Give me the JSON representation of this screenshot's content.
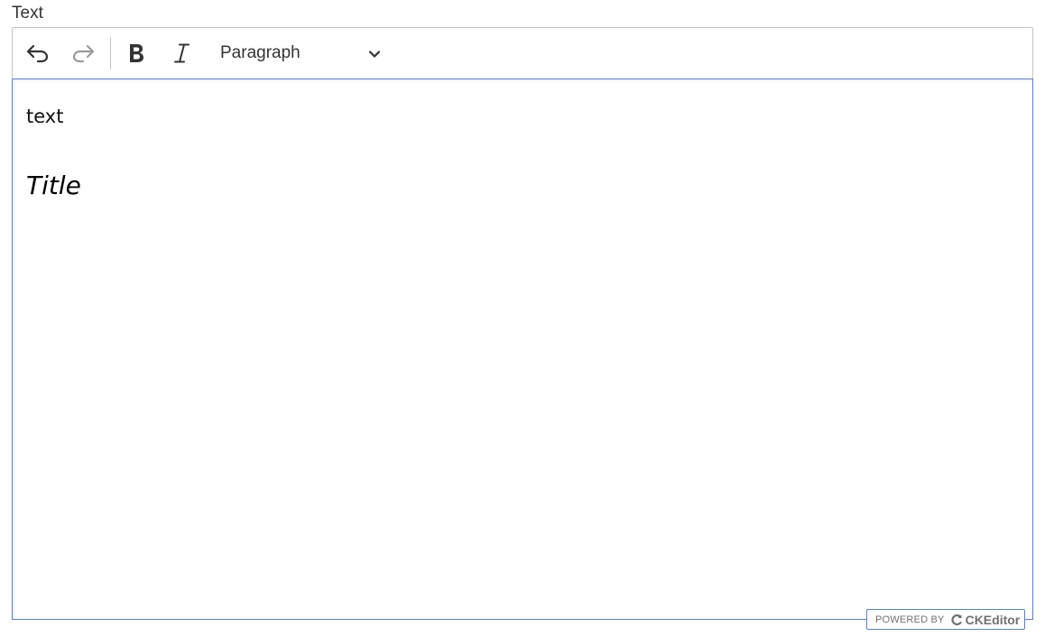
{
  "field": {
    "label": "Text"
  },
  "toolbar": {
    "undo_icon": "undo-icon",
    "redo_icon": "redo-icon",
    "bold_icon": "bold-icon",
    "italic_icon": "italic-icon",
    "heading_value": "Paragraph",
    "dropdown_icon": "chevron-down-icon"
  },
  "content": {
    "paragraph": "text",
    "title": "Title"
  },
  "badge": {
    "powered_by": "POWERED BY",
    "brand": "CKEditor"
  },
  "colors": {
    "focus_border": "#5a7fd6",
    "toolbar_border": "#c4c4c4",
    "icon_active": "#333333",
    "icon_disabled": "#9a9a9a"
  }
}
